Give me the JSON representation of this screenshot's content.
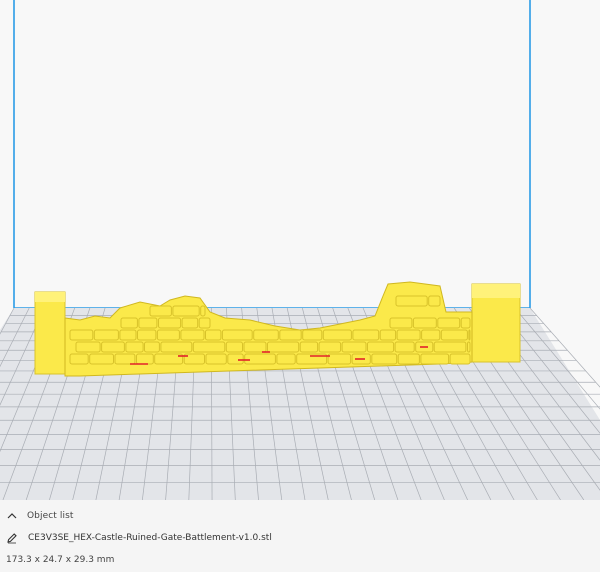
{
  "object_list": {
    "title": "Object list",
    "file_name": "CE3V3SE_HEX-Castle-Ruined-Gate-Battlement-v1.0.stl",
    "dimensions": "173.3 x 24.7 x 29.3 mm"
  },
  "viewport": {
    "background_color": "#f8f8f8",
    "build_volume_edge_color": "#2a9be6",
    "grid_line_color": "#a9adb4",
    "plate_color": "#e2e4e8",
    "model_color": "#fbe94a",
    "model_shadow_color": "#d8c22a",
    "overhang_color": "#e2222a",
    "model_name": "HEX-Castle-Ruined-Gate-Battlement"
  },
  "icons": {
    "collapse": "chevron-up-icon",
    "edit": "pencil-icon"
  }
}
